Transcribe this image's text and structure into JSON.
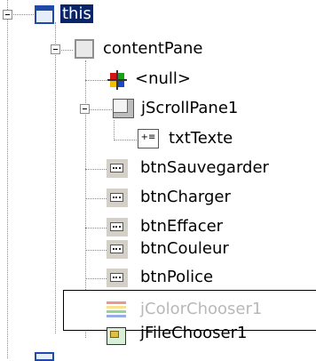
{
  "tree": {
    "root_label": "this",
    "content_pane_label": "contentPane",
    "null_label": "<null>",
    "scroll_pane_label": "jScrollPane1",
    "text_label": "txtTexte",
    "buttons": [
      {
        "label": "btnSauvegarder"
      },
      {
        "label": "btnCharger"
      },
      {
        "label": "btnEffacer"
      },
      {
        "label": "btnCouleur"
      },
      {
        "label": "btnPolice"
      }
    ],
    "color_chooser_label": "jColorChooser1",
    "file_chooser_label": "jFileChooser1"
  },
  "colors": {
    "selection": "#0a246a",
    "tree_lines": "#8a8a8a"
  }
}
